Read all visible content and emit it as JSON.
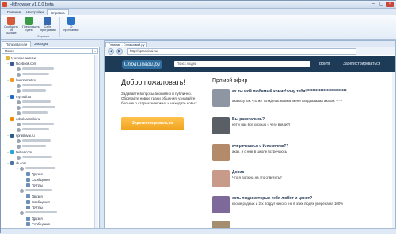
{
  "window": {
    "title": "HitBrowser v1.0.0 beta",
    "controls": [
      "–",
      "▢",
      "×"
    ]
  },
  "menu": {
    "tabs": [
      "Главная",
      "Настройки",
      "Справка"
    ],
    "active": 2
  },
  "ribbon": {
    "buttons": [
      {
        "label": "Сообщить об ошибке",
        "icon": "bug-report-icon",
        "color": "#d45a3a"
      },
      {
        "label": "Предложить идею",
        "icon": "lightbulb-icon",
        "color": "#3b9b45"
      },
      {
        "label": "Сайт программы",
        "icon": "globe-icon",
        "color": "#3569b4"
      },
      {
        "label": "О программе",
        "icon": "info-icon",
        "color": "#2b73c6"
      }
    ],
    "group_label": "Справка"
  },
  "left_panel": {
    "tabs": [
      "Пользователи",
      "Закладки"
    ],
    "search_placeholder": "Поиск",
    "tree": {
      "root": "Учетные записи",
      "sites": [
        {
          "name": "facebook.com",
          "icon": "facebook-icon",
          "color": "#3b5998"
        },
        {
          "name": "liveinternet.ru",
          "icon": "liveinternet-icon",
          "color": "#f29b20"
        },
        {
          "name": "my.mail.ru",
          "icon": "mailru-icon",
          "color": "#1f6bc7"
        },
        {
          "name": "odnoklassniki.ru",
          "icon": "odnoklassniki-icon",
          "color": "#f28b00"
        },
        {
          "name": "sprashivai.ru",
          "icon": "sprashivai-icon",
          "color": "#2b5d8a"
        },
        {
          "name": "twitter.com",
          "icon": "twitter-icon",
          "color": "#29a4d9"
        },
        {
          "name": "vk.com",
          "icon": "vk-icon",
          "color": "#4c75a3"
        }
      ],
      "vk_children": [
        "Друзья",
        "Сообщения",
        "Группы"
      ]
    }
  },
  "browser": {
    "tab_label": "Главная - Спрашивай.ру",
    "url": "http://sprashivai.ru/",
    "nav": [
      "◀",
      "▶"
    ]
  },
  "site": {
    "logo": "Спрашивай.ру",
    "search_placeholder": "Поиск людей",
    "login": "Войти",
    "register_link": "Зарегистрироваться",
    "welcome_title": "Добро пожаловать!",
    "welcome_text": "Задавайте вопросы анонимно и публично. Обретайте новые грани общения, узнавайте больше о старых знакомых и находите новых.",
    "register_button": "Зарегистрироваться",
    "feed_title": "Прямой эфир",
    "feed": [
      {
        "title": "ах ты мой любимый комик!хочу тебя!**************************",
        "text": "ахахаху так что же ты ждешь возьми меня пандааааааа ахахах *****"
      },
      {
        "title": "Вы расстались?",
        "text": "нет у нас все хорошо с чего взяли?)"
      },
      {
        "title": "вчерачешься с Илюзинны??",
        "text": "ахах, я с ним в школе встречаюсь"
      },
      {
        "title": "Денис",
        "text": "Что я должна на это ответить?"
      },
      {
        "title": "есть люди,которые тебя любят и ценят?",
        "text": "кроме родных и 2-х подруг никого, но в этих людях уверена на 100%"
      }
    ]
  }
}
